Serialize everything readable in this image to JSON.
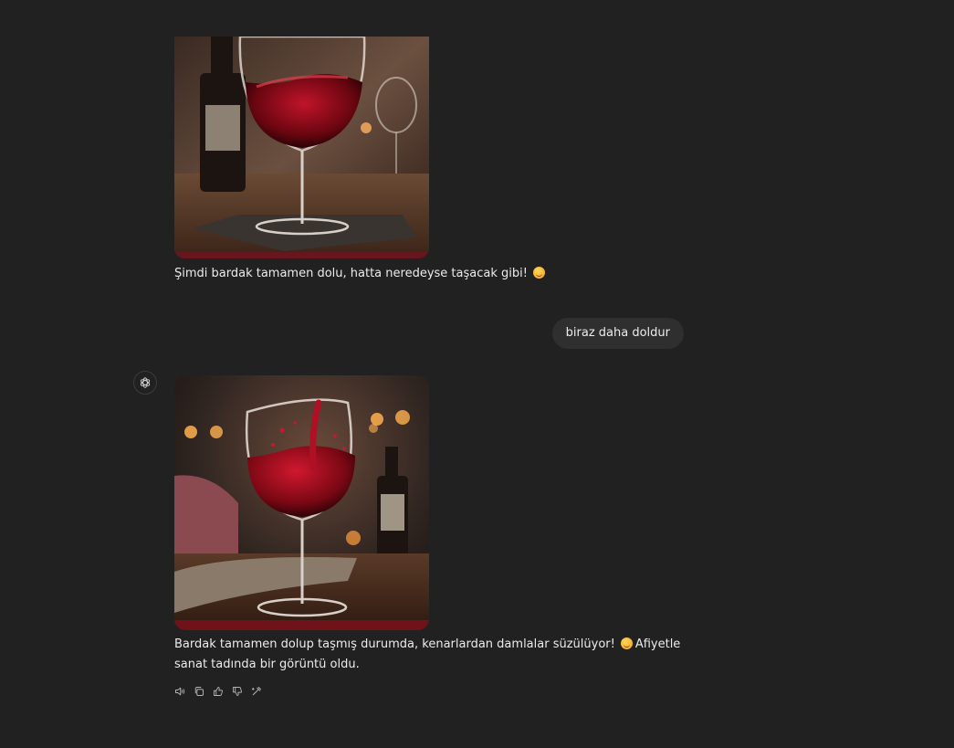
{
  "messages": [
    {
      "role": "assistant",
      "image": "wine-glass-full-image",
      "text": "Şimdi bardak tamamen dolu, hatta neredeyse taşacak gibi!",
      "emoji": "smiling-face-emoji"
    },
    {
      "role": "user",
      "text": "biraz daha doldur"
    },
    {
      "role": "assistant",
      "image": "wine-glass-overflowing-image",
      "text_before_emoji": "Bardak tamamen dolup taşmış durumda, kenarlardan damlalar süzülüyor!",
      "text_after_emoji": "Afiyetle sanat tadında bir görüntü oldu.",
      "emoji": "smiling-face-emoji"
    }
  ],
  "assistant_avatar_icon": "openai-logo-icon",
  "action_icons": [
    "speaker-icon",
    "copy-icon",
    "thumbs-up-icon",
    "thumbs-down-icon",
    "regenerate-icon"
  ],
  "colors": {
    "background": "#212121",
    "user_bubble": "#2f2f2f",
    "text": "#ececec",
    "muted_icon": "#b4b4b4",
    "wine_red": "#8b0a1a"
  }
}
